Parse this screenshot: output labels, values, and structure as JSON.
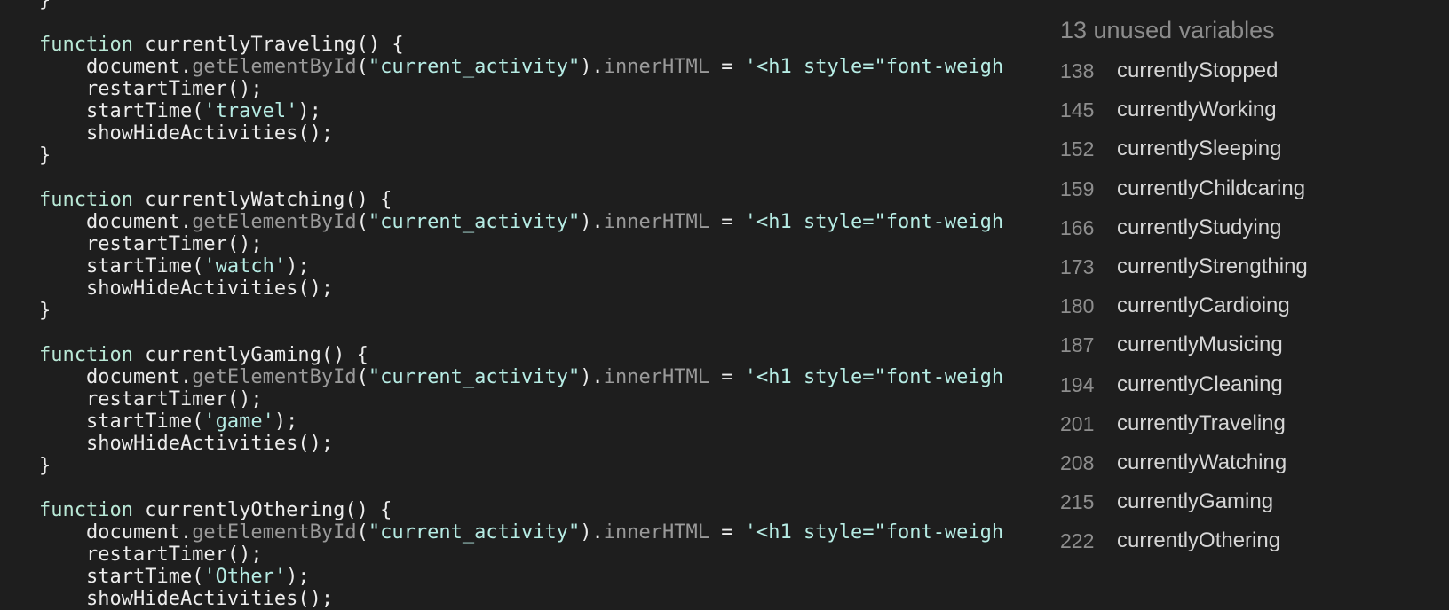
{
  "code": {
    "lines": [
      "}",
      "",
      "function currentlyTraveling() {",
      "    document.getElementById(\"current_activity\").innerHTML = '<h1 style=\"font-weigh",
      "    restartTimer();",
      "    startTime('travel');",
      "    showHideActivities();",
      "}",
      "",
      "function currentlyWatching() {",
      "    document.getElementById(\"current_activity\").innerHTML = '<h1 style=\"font-weigh",
      "    restartTimer();",
      "    startTime('watch');",
      "    showHideActivities();",
      "}",
      "",
      "function currentlyGaming() {",
      "    document.getElementById(\"current_activity\").innerHTML = '<h1 style=\"font-weigh",
      "    restartTimer();",
      "    startTime('game');",
      "    showHideActivities();",
      "}",
      "",
      "function currentlyOthering() {",
      "    document.getElementById(\"current_activity\").innerHTML = '<h1 style=\"font-weigh",
      "    restartTimer();",
      "    startTime('Other');",
      "    showHideActivities();"
    ]
  },
  "sidebar": {
    "title": "13 unused variables",
    "items": [
      {
        "line": "138",
        "name": "currentlyStopped"
      },
      {
        "line": "145",
        "name": "currentlyWorking"
      },
      {
        "line": "152",
        "name": "currentlySleeping"
      },
      {
        "line": "159",
        "name": "currentlyChildcaring"
      },
      {
        "line": "166",
        "name": "currentlyStudying"
      },
      {
        "line": "173",
        "name": "currentlyStrengthing"
      },
      {
        "line": "180",
        "name": "currentlyCardioing"
      },
      {
        "line": "187",
        "name": "currentlyMusicing"
      },
      {
        "line": "194",
        "name": "currentlyCleaning"
      },
      {
        "line": "201",
        "name": "currentlyTraveling"
      },
      {
        "line": "208",
        "name": "currentlyWatching"
      },
      {
        "line": "215",
        "name": "currentlyGaming"
      },
      {
        "line": "222",
        "name": "currentlyOthering"
      }
    ]
  }
}
